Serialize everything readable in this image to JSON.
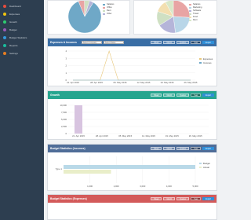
{
  "sidebar": {
    "items": [
      {
        "label": "Dashboard",
        "color": "#e84c3d"
      },
      {
        "label": "Expenses",
        "color": "#f1c40f"
      },
      {
        "label": "Growth",
        "color": "#2ecc71"
      },
      {
        "label": "Budget",
        "color": "#9b59b6"
      },
      {
        "label": "Budget Statistics",
        "color": "#3498db"
      },
      {
        "label": "Reports",
        "color": "#1abc9c"
      },
      {
        "label": "Settings",
        "color": "#e67e22"
      }
    ]
  },
  "pie_left": {
    "legend": [
      "Salaries",
      "Office",
      "Rent",
      "Other"
    ],
    "colors": [
      "#6fa8c7",
      "#e8a4a4",
      "#cfe0c3",
      "#b5b5d9"
    ],
    "values": [
      85,
      6,
      5,
      4
    ]
  },
  "pie_right": {
    "legend": [
      "Salaries",
      "Marketing",
      "Software",
      "Travel",
      "Food",
      "Rent"
    ],
    "colors": [
      "#e8a4a4",
      "#b9d6e8",
      "#b5b5d9",
      "#cfe0c3",
      "#f3dfb0",
      "#d8e8c9"
    ],
    "values": [
      26,
      22,
      18,
      14,
      12,
      8
    ]
  },
  "expenses": {
    "title": "Expenses & Incomes",
    "color": "#3a6ea5",
    "select1": "Select Company",
    "select2": "Select Dates",
    "buttons": [
      "Week",
      "Month",
      "Quarter",
      "Year"
    ],
    "active": 3,
    "extra_button": "Export"
  },
  "growth": {
    "title": "Growth",
    "color": "#27a58f",
    "buttons": [
      "Week",
      "Month",
      "Quarter",
      "Year"
    ],
    "active": 3,
    "extra_button": "Export"
  },
  "budget": {
    "title": "Budget Statistics (Incomes)",
    "color": "#4f6d98",
    "buttons": [
      "Week",
      "Month",
      "Quarter",
      "Year"
    ],
    "active": 3,
    "extra_button": "Export"
  },
  "budget2": {
    "title": "Budget Statistics (Expenses)",
    "color": "#d35a5a",
    "buttons": [
      "Week",
      "Month",
      "Quarter",
      "Year"
    ],
    "active": 3,
    "extra_button": "Export"
  },
  "chart_data": [
    {
      "type": "line",
      "x": [
        "21. Apr 2015",
        "24. Apr 2015",
        "27. Apr 2015",
        "30. Apr 2015",
        "03. May 2015",
        "06. May 2015",
        "09. May 2015",
        "12. May 2015",
        "15. May 2015",
        "18. May 2015",
        "21. May 2015",
        "24. May 2015",
        "27. May 2015",
        "30. May 2015"
      ],
      "x_ticks": [
        "21. Apr 2015",
        "28. Apr 2015",
        "05. May 2015",
        "12. May 2015",
        "19. May 2015",
        "26. May 2015"
      ],
      "series": [
        {
          "name": "Expenses",
          "values": [
            0,
            0,
            0,
            0,
            4,
            0,
            0,
            0,
            0,
            0,
            0,
            0,
            0,
            0
          ],
          "color": "#e8c77a"
        },
        {
          "name": "Incomes",
          "values": [
            0,
            0,
            0,
            0,
            0,
            0,
            0,
            0,
            0,
            0,
            0,
            0,
            0,
            0
          ],
          "color": "#6fa8c7"
        }
      ],
      "ylim": [
        0,
        4
      ],
      "y_ticks": [
        0,
        1,
        2,
        3,
        4
      ],
      "legend_position": "right"
    },
    {
      "type": "bar",
      "x_ticks": [
        "21. Apr 2015",
        "28. Apr 2015",
        "05. May 2015",
        "12. May 2015",
        "19. May 2015",
        "26. May 2015"
      ],
      "series": [
        {
          "values": [
            10000,
            0,
            0,
            0,
            0,
            0
          ],
          "color": "#d8c4e0"
        }
      ],
      "ylim": [
        0,
        10000
      ],
      "y_ticks": [
        "0",
        "2,500",
        "5,000",
        "7,500",
        "10,000"
      ]
    },
    {
      "type": "bar",
      "orientation": "horizontal",
      "categories": [
        "Type 1"
      ],
      "series": [
        {
          "name": "Budget",
          "values": [
            5000
          ],
          "color": "#b9d9e8"
        },
        {
          "name": "Actual",
          "values": [
            1800
          ],
          "color": "#e9eec9"
        }
      ],
      "xlim": [
        0,
        5000
      ],
      "x_ticks": [
        "1,000",
        "2,000",
        "3,000",
        "4,000",
        "5,000"
      ],
      "legend_position": "right"
    }
  ]
}
